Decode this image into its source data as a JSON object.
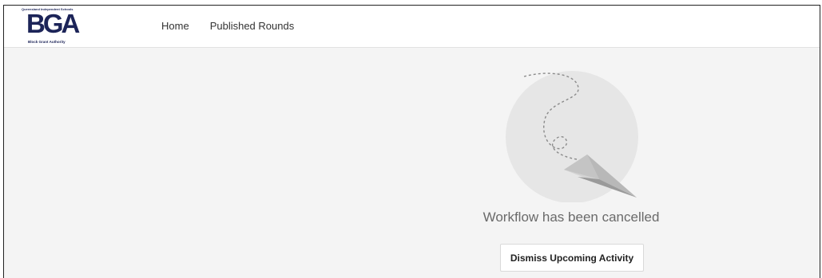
{
  "logo": {
    "top_text": "Queensland Independent Schools",
    "main_text": "BGA",
    "bottom_text": "Block Grant Authority",
    "color": "#1c2458"
  },
  "nav": {
    "items": [
      {
        "label": "Home"
      },
      {
        "label": "Published Rounds"
      }
    ]
  },
  "main": {
    "status_message": "Workflow has been cancelled",
    "dismiss_label": "Dismiss Upcoming Activity",
    "illustration_icon": "paper-plane-icon"
  }
}
